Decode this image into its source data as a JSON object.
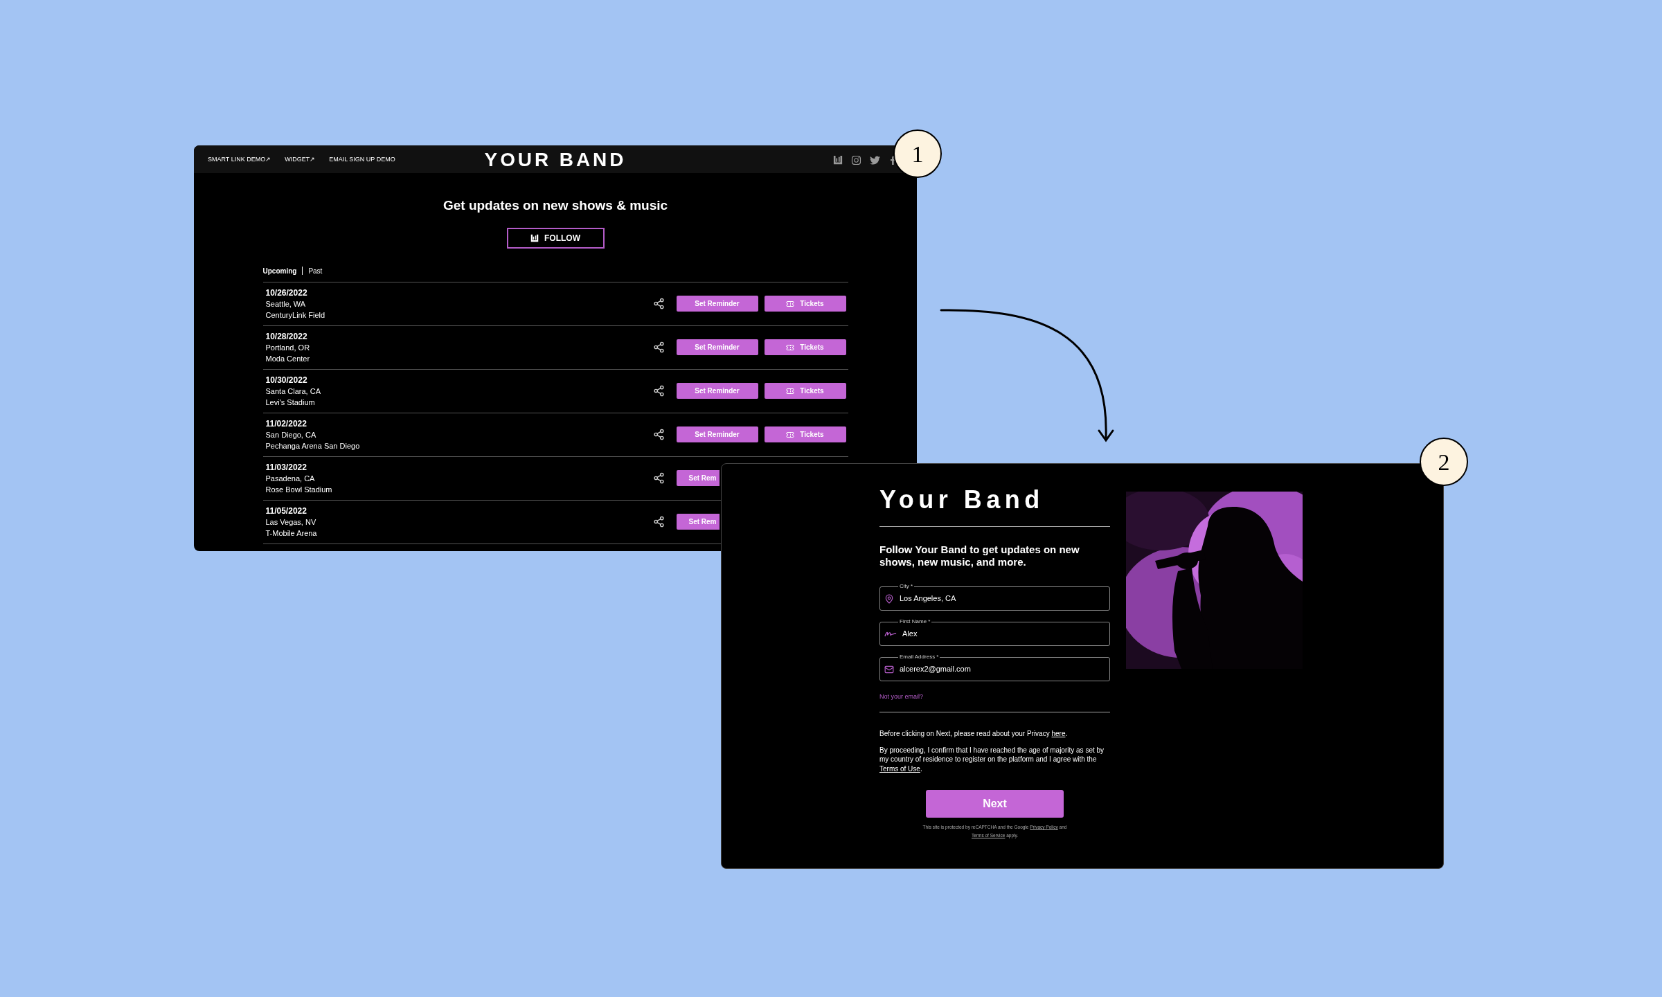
{
  "step_badges": [
    "1",
    "2"
  ],
  "window_1": {
    "nav_links": [
      "SMART LINK DEMO↗",
      "WIDGET↗",
      "EMAIL SIGN UP DEMO"
    ],
    "logo": "YOUR BAND",
    "heading": "Get updates on new shows & music",
    "follow_button": "FOLLOW",
    "tabs": [
      {
        "label": "Upcoming",
        "selected": true
      },
      {
        "label": "Past",
        "selected": false
      }
    ],
    "events": [
      {
        "date": "10/26/2022",
        "city": "Seattle, WA",
        "venue": "CenturyLink Field",
        "reminder_button": "Set Reminder",
        "tickets_button": "Tickets"
      },
      {
        "date": "10/28/2022",
        "city": "Portland, OR",
        "venue": "Moda Center",
        "reminder_button": "Set Reminder",
        "tickets_button": "Tickets"
      },
      {
        "date": "10/30/2022",
        "city": "Santa Clara, CA",
        "venue": "Levi's Stadium",
        "reminder_button": "Set Reminder",
        "tickets_button": "Tickets"
      },
      {
        "date": "11/02/2022",
        "city": "San Diego, CA",
        "venue": "Pechanga Arena San Diego",
        "reminder_button": "Set Reminder",
        "tickets_button": "Tickets"
      },
      {
        "date": "11/03/2022",
        "city": "Pasadena, CA",
        "venue": "Rose Bowl Stadium",
        "reminder_button": "Set Rem"
      },
      {
        "date": "11/05/2022",
        "city": "Las Vegas, NV",
        "venue": "T-Mobile Arena",
        "reminder_button": "Set Rem"
      }
    ]
  },
  "window_2": {
    "logo": "Your Band",
    "intro": "Follow Your Band to get updates on new shows, new music, and more.",
    "fields": [
      {
        "kind": "location",
        "label": "City *",
        "value": "Los Angeles, CA"
      },
      {
        "kind": "name",
        "label": "First Name *",
        "value": "Alex"
      },
      {
        "kind": "email",
        "label": "Email Address *",
        "value": "alcerex2@gmail.com"
      }
    ],
    "not_your_email": "Not your email?",
    "privacy_note": [
      {
        "text": "Before clicking on Next, please read about your Privacy ",
        "link": false
      },
      {
        "text": "here",
        "link": true
      },
      {
        "text": ".",
        "link": false
      }
    ],
    "consent": [
      {
        "text": "By proceeding, I confirm that I have reached the age of majority as set by my country of residence to register on the platform and I agree with the ",
        "link": false
      },
      {
        "text": "Terms of Use",
        "link": true
      },
      {
        "text": ".",
        "link": false
      }
    ],
    "next_button": "Next",
    "recaptcha_note": [
      {
        "text": "This site is protected by reCAPTCHA and the Google ",
        "link": false
      },
      {
        "text": "Privacy Policy",
        "link": true
      },
      {
        "text": " and ",
        "link": false
      },
      {
        "text": "Terms of Service",
        "link": true
      },
      {
        "text": " apply.",
        "link": false
      }
    ]
  }
}
